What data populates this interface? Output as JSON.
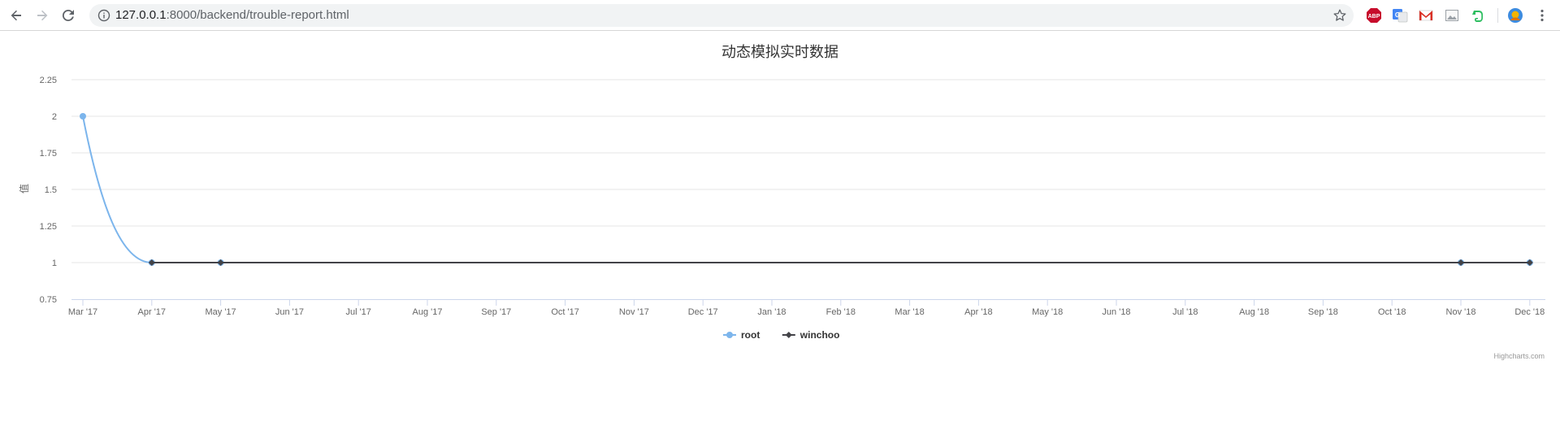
{
  "browser": {
    "url_host": "127.0.0.1",
    "url_rest": ":8000/backend/trouble-report.html",
    "extensions": [
      "adblock-plus-icon",
      "google-translate-icon",
      "gmail-icon",
      "image-extension-icon",
      "evernote-icon",
      "profile-avatar-icon"
    ]
  },
  "chart_data": {
    "type": "line",
    "title": "动态模拟实时数据",
    "xlabel": "",
    "ylabel": "值",
    "ylim": [
      0.75,
      2.25
    ],
    "yticks": [
      "0.75",
      "1",
      "1.25",
      "1.5",
      "1.75",
      "2",
      "2.25"
    ],
    "ytick_values": [
      0.75,
      1,
      1.25,
      1.5,
      1.75,
      2,
      2.25
    ],
    "x_tick_labels": [
      "Mar '17",
      "Apr '17",
      "May '17",
      "Jun '17",
      "Jul '17",
      "Aug '17",
      "Sep '17",
      "Oct '17",
      "Nov '17",
      "Dec '17",
      "Jan '18",
      "Feb '18",
      "Mar '18",
      "Apr '18",
      "May '18",
      "Jun '18",
      "Jul '18",
      "Aug '18",
      "Sep '18",
      "Oct '18",
      "Nov '18",
      "Dec '18"
    ],
    "x_range": [
      "2017-03",
      "2018-12"
    ],
    "grid": true,
    "legend_position": "bottom-center",
    "series": [
      {
        "name": "root",
        "color": "#7cb5ec",
        "marker": "circle",
        "points": [
          {
            "x": "2017-03",
            "y": 2
          },
          {
            "x": "2017-04",
            "y": 1
          },
          {
            "x": "2017-05",
            "y": 1
          },
          {
            "x": "2018-11",
            "y": 1
          },
          {
            "x": "2018-12",
            "y": 1
          }
        ]
      },
      {
        "name": "winchoo",
        "color": "#434348",
        "marker": "diamond",
        "points": [
          {
            "x": "2017-04",
            "y": 1
          },
          {
            "x": "2017-05",
            "y": 1
          },
          {
            "x": "2018-11",
            "y": 1
          },
          {
            "x": "2018-12",
            "y": 1
          }
        ]
      }
    ],
    "credits": "Highcharts.com"
  }
}
